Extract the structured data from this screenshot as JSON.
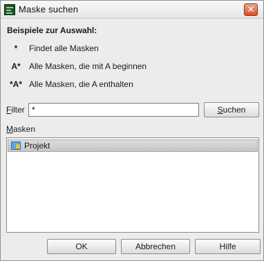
{
  "window": {
    "title": "Maske suchen",
    "close_symbol": "✕"
  },
  "examples": {
    "title": "Beispiele zur Auswahl:",
    "items": [
      {
        "symbol": "*",
        "description": "Findet alle Masken"
      },
      {
        "symbol": "A*",
        "description": "Alle Masken, die mit A beginnen"
      },
      {
        "symbol": "*A*",
        "description": "Alle Masken, die A enthalten"
      }
    ]
  },
  "filter": {
    "label": "Filter",
    "mnemonic": "F",
    "label_rest": "ilter",
    "value": "*"
  },
  "search_button": {
    "label": "Suchen",
    "mnemonic": "S",
    "label_rest": "uchen"
  },
  "masks": {
    "label": "Masken",
    "mnemonic": "M",
    "label_rest": "asken",
    "items": [
      {
        "label": "Projekt",
        "icon": "folder-icon",
        "selected": true
      }
    ]
  },
  "buttons": {
    "ok": "OK",
    "cancel": "Abbrechen",
    "help": "Hilfe"
  }
}
